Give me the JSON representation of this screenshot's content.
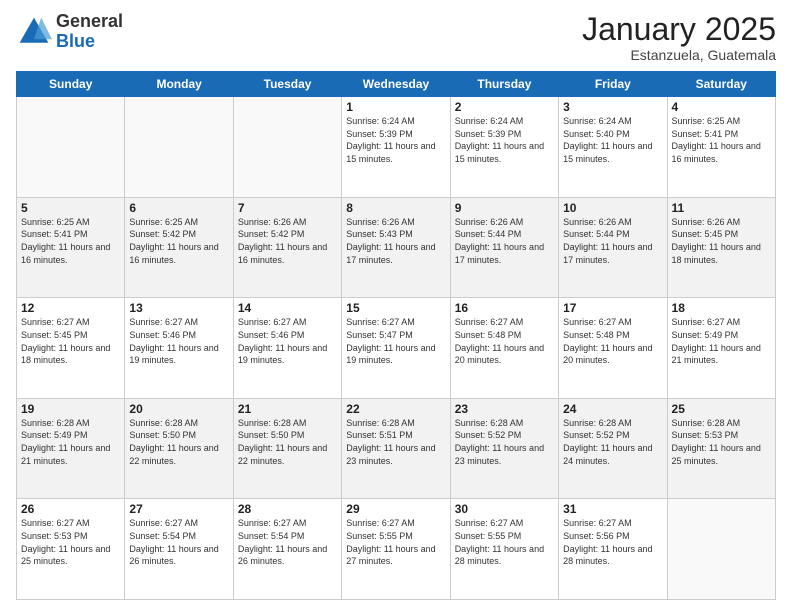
{
  "logo": {
    "general": "General",
    "blue": "Blue"
  },
  "header": {
    "month": "January 2025",
    "location": "Estanzuela, Guatemala"
  },
  "weekdays": [
    "Sunday",
    "Monday",
    "Tuesday",
    "Wednesday",
    "Thursday",
    "Friday",
    "Saturday"
  ],
  "weeks": [
    [
      {
        "day": "",
        "info": ""
      },
      {
        "day": "",
        "info": ""
      },
      {
        "day": "",
        "info": ""
      },
      {
        "day": "1",
        "info": "Sunrise: 6:24 AM\nSunset: 5:39 PM\nDaylight: 11 hours and 15 minutes."
      },
      {
        "day": "2",
        "info": "Sunrise: 6:24 AM\nSunset: 5:39 PM\nDaylight: 11 hours and 15 minutes."
      },
      {
        "day": "3",
        "info": "Sunrise: 6:24 AM\nSunset: 5:40 PM\nDaylight: 11 hours and 15 minutes."
      },
      {
        "day": "4",
        "info": "Sunrise: 6:25 AM\nSunset: 5:41 PM\nDaylight: 11 hours and 16 minutes."
      }
    ],
    [
      {
        "day": "5",
        "info": "Sunrise: 6:25 AM\nSunset: 5:41 PM\nDaylight: 11 hours and 16 minutes."
      },
      {
        "day": "6",
        "info": "Sunrise: 6:25 AM\nSunset: 5:42 PM\nDaylight: 11 hours and 16 minutes."
      },
      {
        "day": "7",
        "info": "Sunrise: 6:26 AM\nSunset: 5:42 PM\nDaylight: 11 hours and 16 minutes."
      },
      {
        "day": "8",
        "info": "Sunrise: 6:26 AM\nSunset: 5:43 PM\nDaylight: 11 hours and 17 minutes."
      },
      {
        "day": "9",
        "info": "Sunrise: 6:26 AM\nSunset: 5:44 PM\nDaylight: 11 hours and 17 minutes."
      },
      {
        "day": "10",
        "info": "Sunrise: 6:26 AM\nSunset: 5:44 PM\nDaylight: 11 hours and 17 minutes."
      },
      {
        "day": "11",
        "info": "Sunrise: 6:26 AM\nSunset: 5:45 PM\nDaylight: 11 hours and 18 minutes."
      }
    ],
    [
      {
        "day": "12",
        "info": "Sunrise: 6:27 AM\nSunset: 5:45 PM\nDaylight: 11 hours and 18 minutes."
      },
      {
        "day": "13",
        "info": "Sunrise: 6:27 AM\nSunset: 5:46 PM\nDaylight: 11 hours and 19 minutes."
      },
      {
        "day": "14",
        "info": "Sunrise: 6:27 AM\nSunset: 5:46 PM\nDaylight: 11 hours and 19 minutes."
      },
      {
        "day": "15",
        "info": "Sunrise: 6:27 AM\nSunset: 5:47 PM\nDaylight: 11 hours and 19 minutes."
      },
      {
        "day": "16",
        "info": "Sunrise: 6:27 AM\nSunset: 5:48 PM\nDaylight: 11 hours and 20 minutes."
      },
      {
        "day": "17",
        "info": "Sunrise: 6:27 AM\nSunset: 5:48 PM\nDaylight: 11 hours and 20 minutes."
      },
      {
        "day": "18",
        "info": "Sunrise: 6:27 AM\nSunset: 5:49 PM\nDaylight: 11 hours and 21 minutes."
      }
    ],
    [
      {
        "day": "19",
        "info": "Sunrise: 6:28 AM\nSunset: 5:49 PM\nDaylight: 11 hours and 21 minutes."
      },
      {
        "day": "20",
        "info": "Sunrise: 6:28 AM\nSunset: 5:50 PM\nDaylight: 11 hours and 22 minutes."
      },
      {
        "day": "21",
        "info": "Sunrise: 6:28 AM\nSunset: 5:50 PM\nDaylight: 11 hours and 22 minutes."
      },
      {
        "day": "22",
        "info": "Sunrise: 6:28 AM\nSunset: 5:51 PM\nDaylight: 11 hours and 23 minutes."
      },
      {
        "day": "23",
        "info": "Sunrise: 6:28 AM\nSunset: 5:52 PM\nDaylight: 11 hours and 23 minutes."
      },
      {
        "day": "24",
        "info": "Sunrise: 6:28 AM\nSunset: 5:52 PM\nDaylight: 11 hours and 24 minutes."
      },
      {
        "day": "25",
        "info": "Sunrise: 6:28 AM\nSunset: 5:53 PM\nDaylight: 11 hours and 25 minutes."
      }
    ],
    [
      {
        "day": "26",
        "info": "Sunrise: 6:27 AM\nSunset: 5:53 PM\nDaylight: 11 hours and 25 minutes."
      },
      {
        "day": "27",
        "info": "Sunrise: 6:27 AM\nSunset: 5:54 PM\nDaylight: 11 hours and 26 minutes."
      },
      {
        "day": "28",
        "info": "Sunrise: 6:27 AM\nSunset: 5:54 PM\nDaylight: 11 hours and 26 minutes."
      },
      {
        "day": "29",
        "info": "Sunrise: 6:27 AM\nSunset: 5:55 PM\nDaylight: 11 hours and 27 minutes."
      },
      {
        "day": "30",
        "info": "Sunrise: 6:27 AM\nSunset: 5:55 PM\nDaylight: 11 hours and 28 minutes."
      },
      {
        "day": "31",
        "info": "Sunrise: 6:27 AM\nSunset: 5:56 PM\nDaylight: 11 hours and 28 minutes."
      },
      {
        "day": "",
        "info": ""
      }
    ]
  ],
  "colors": {
    "header_bg": "#1a6bb5",
    "header_text": "#ffffff",
    "border": "#cccccc",
    "shade_row": "#f2f2f2",
    "empty_cell": "#f9f9f9"
  }
}
